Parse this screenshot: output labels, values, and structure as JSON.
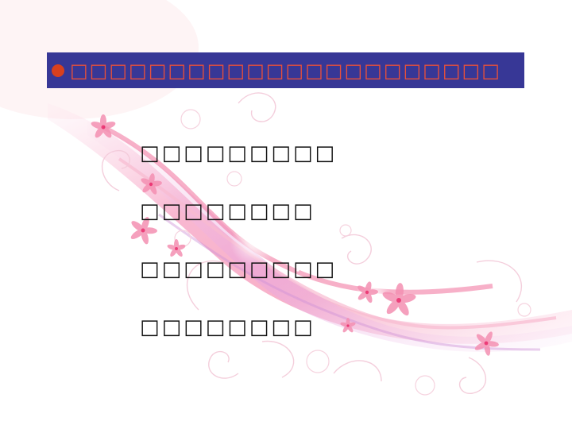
{
  "slide": {
    "title": "□□□□□□□□□□□□□□□□□□□□□□",
    "lines": [
      "□□□□□□□□□",
      "□□□□□□□□",
      "□□□□□□□□□",
      "□□□□□□□□"
    ]
  },
  "colors": {
    "title_bar": "#373796",
    "title_text": "#e8503a",
    "bullet": "#d8401e",
    "body_text": "#111111",
    "decor_pink": "#f48fb1"
  },
  "icons": {
    "bullet": "red-circle-bullet-icon",
    "decoration": "pink-flower-swirl-decoration"
  }
}
